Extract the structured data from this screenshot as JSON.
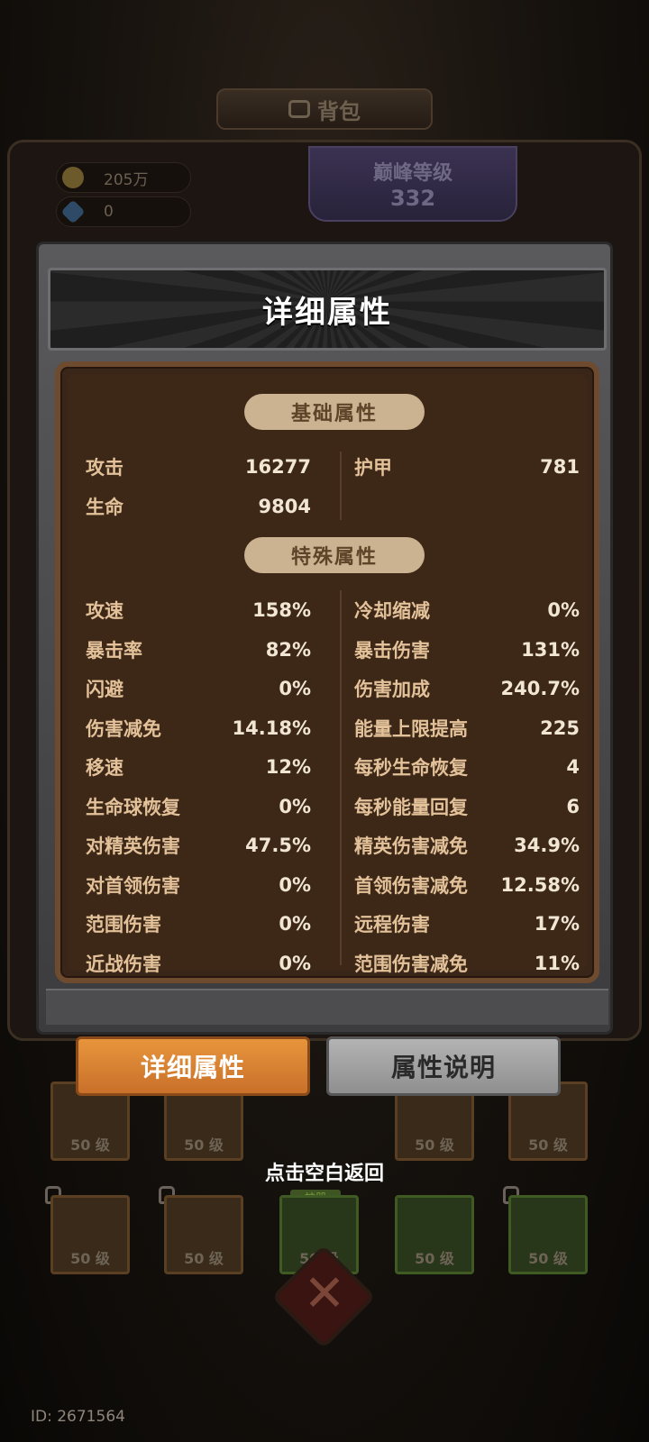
{
  "background": {
    "title": "背包",
    "gold": "205万",
    "gems": "0",
    "peak_label": "巅峰等级",
    "peak_value": "332",
    "god_tag": "神器",
    "slot_level": "50 级"
  },
  "modal": {
    "title": "详细属性",
    "basic_section": "基础属性",
    "special_section": "特殊属性",
    "basic_left": [
      {
        "k": "攻击",
        "v": "16277"
      },
      {
        "k": "生命",
        "v": "9804"
      }
    ],
    "basic_right": [
      {
        "k": "护甲",
        "v": "781"
      }
    ],
    "special_left": [
      {
        "k": "攻速",
        "v": "158%"
      },
      {
        "k": "暴击率",
        "v": "82%"
      },
      {
        "k": "闪避",
        "v": "0%"
      },
      {
        "k": "伤害减免",
        "v": "14.18%"
      },
      {
        "k": "移速",
        "v": "12%"
      },
      {
        "k": "生命球恢复",
        "v": "0%"
      },
      {
        "k": "对精英伤害",
        "v": "47.5%"
      },
      {
        "k": "对首领伤害",
        "v": "0%"
      },
      {
        "k": "范围伤害",
        "v": "0%"
      },
      {
        "k": "近战伤害",
        "v": "0%"
      }
    ],
    "special_right": [
      {
        "k": "冷却缩减",
        "v": "0%"
      },
      {
        "k": "暴击伤害",
        "v": "131%"
      },
      {
        "k": "伤害加成",
        "v": "240.7%"
      },
      {
        "k": "能量上限提高",
        "v": "225"
      },
      {
        "k": "每秒生命恢复",
        "v": "4"
      },
      {
        "k": "每秒能量回复",
        "v": "6"
      },
      {
        "k": "精英伤害减免",
        "v": "34.9%"
      },
      {
        "k": "首领伤害减免",
        "v": "12.58%"
      },
      {
        "k": "远程伤害",
        "v": "17%"
      },
      {
        "k": "范围伤害减免",
        "v": "11%"
      }
    ]
  },
  "tabs": {
    "detail": "详细属性",
    "explain": "属性说明"
  },
  "hint": "点击空白返回",
  "user_id": "ID: 2671564"
}
